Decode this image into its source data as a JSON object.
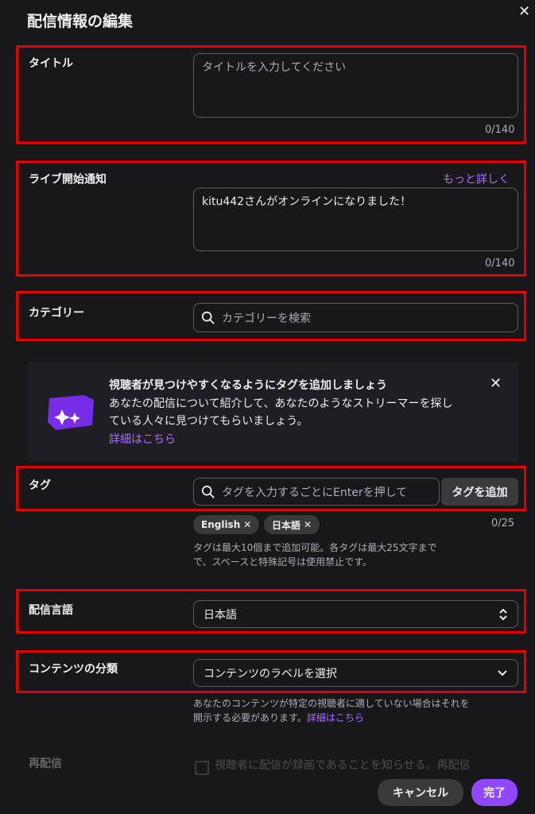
{
  "modal": {
    "title": "配信情報の編集"
  },
  "title_field": {
    "label": "タイトル",
    "placeholder": "タイトルを入力してください",
    "counter": "0/140"
  },
  "notification_field": {
    "label": "ライブ開始通知",
    "learn_more": "もっと詳しく",
    "value": "kitu442さんがオンラインになりました！",
    "counter": "0/140"
  },
  "category_field": {
    "label": "カテゴリー",
    "placeholder": "カテゴリーを検索"
  },
  "tag_banner": {
    "headline": "視聴者が見つけやすくなるようにタグを追加しましょう",
    "body_line1": "あなたの配信について紹介して、あなたのようなストリーマーを探し",
    "body_line2": "ている人々に見つけてもらいましょう。",
    "link": "詳細はこちら"
  },
  "tag_field": {
    "label": "タグ",
    "placeholder": "タグを入力するごとにEnterを押して",
    "add_button": "タグを追加",
    "chips": [
      "English",
      "日本語"
    ],
    "counter": "0/25",
    "help_line1": "タグは最大10個まで追加可能。各タグは最大25文字まで",
    "help_line2": "で、スペースと特殊記号は使用禁止です。"
  },
  "language_field": {
    "label": "配信言語",
    "value": "日本語"
  },
  "content_classification": {
    "label": "コンテンツの分類",
    "value": "コンテンツのラベルを選択",
    "help_line1": "あなたのコンテンツが特定の視聴者に適していない場合はそれを",
    "help_line2": "開示する必要があります。",
    "link": "詳細はこちら"
  },
  "rerun_field": {
    "label": "再配信",
    "checkbox_label": "視聴者に配信が録画であることを知らせる。再配信"
  },
  "footer": {
    "cancel": "キャンセル",
    "done": "完了"
  },
  "colors": {
    "background": "#18181b",
    "accent": "#a970ff",
    "highlight_border": "#e00000"
  }
}
